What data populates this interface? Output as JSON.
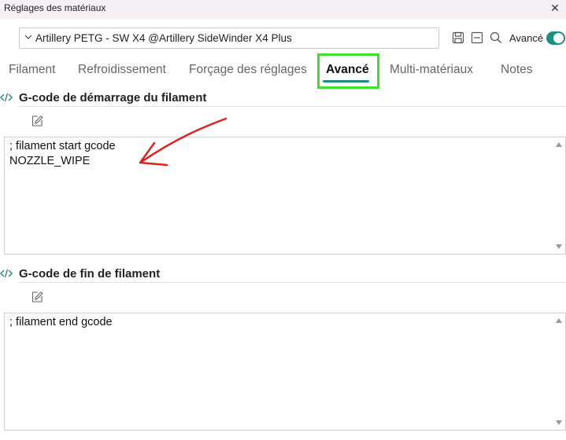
{
  "window": {
    "title": "Réglages des matériaux",
    "close_glyph": "✕"
  },
  "preset": {
    "selected": "Artillery PETG - SW X4 @Artillery SideWinder X4 Plus"
  },
  "toolbar": {
    "icons": [
      "save-icon",
      "minus-square-icon",
      "search-icon"
    ],
    "advanced_label": "Avancé",
    "advanced_on": true
  },
  "tabs": [
    {
      "label": "Filament",
      "active": false
    },
    {
      "label": "Refroidissement",
      "active": false
    },
    {
      "label": "Forçage des réglages",
      "active": false
    },
    {
      "label": "Avancé",
      "active": true
    },
    {
      "label": "Multi-matériaux",
      "active": false
    },
    {
      "label": "Notes",
      "active": false
    }
  ],
  "sections": [
    {
      "title": "G-code de démarrage du filament",
      "code": "; filament start gcode\nNOZZLE_WIPE"
    },
    {
      "title": "G-code de fin de filament",
      "code": "; filament end gcode"
    }
  ],
  "colors": {
    "accent": "#18907f",
    "toggle": "#1c8f82",
    "highlight_frame": "#3ee02a",
    "annotation_arrow": "#e02020"
  }
}
